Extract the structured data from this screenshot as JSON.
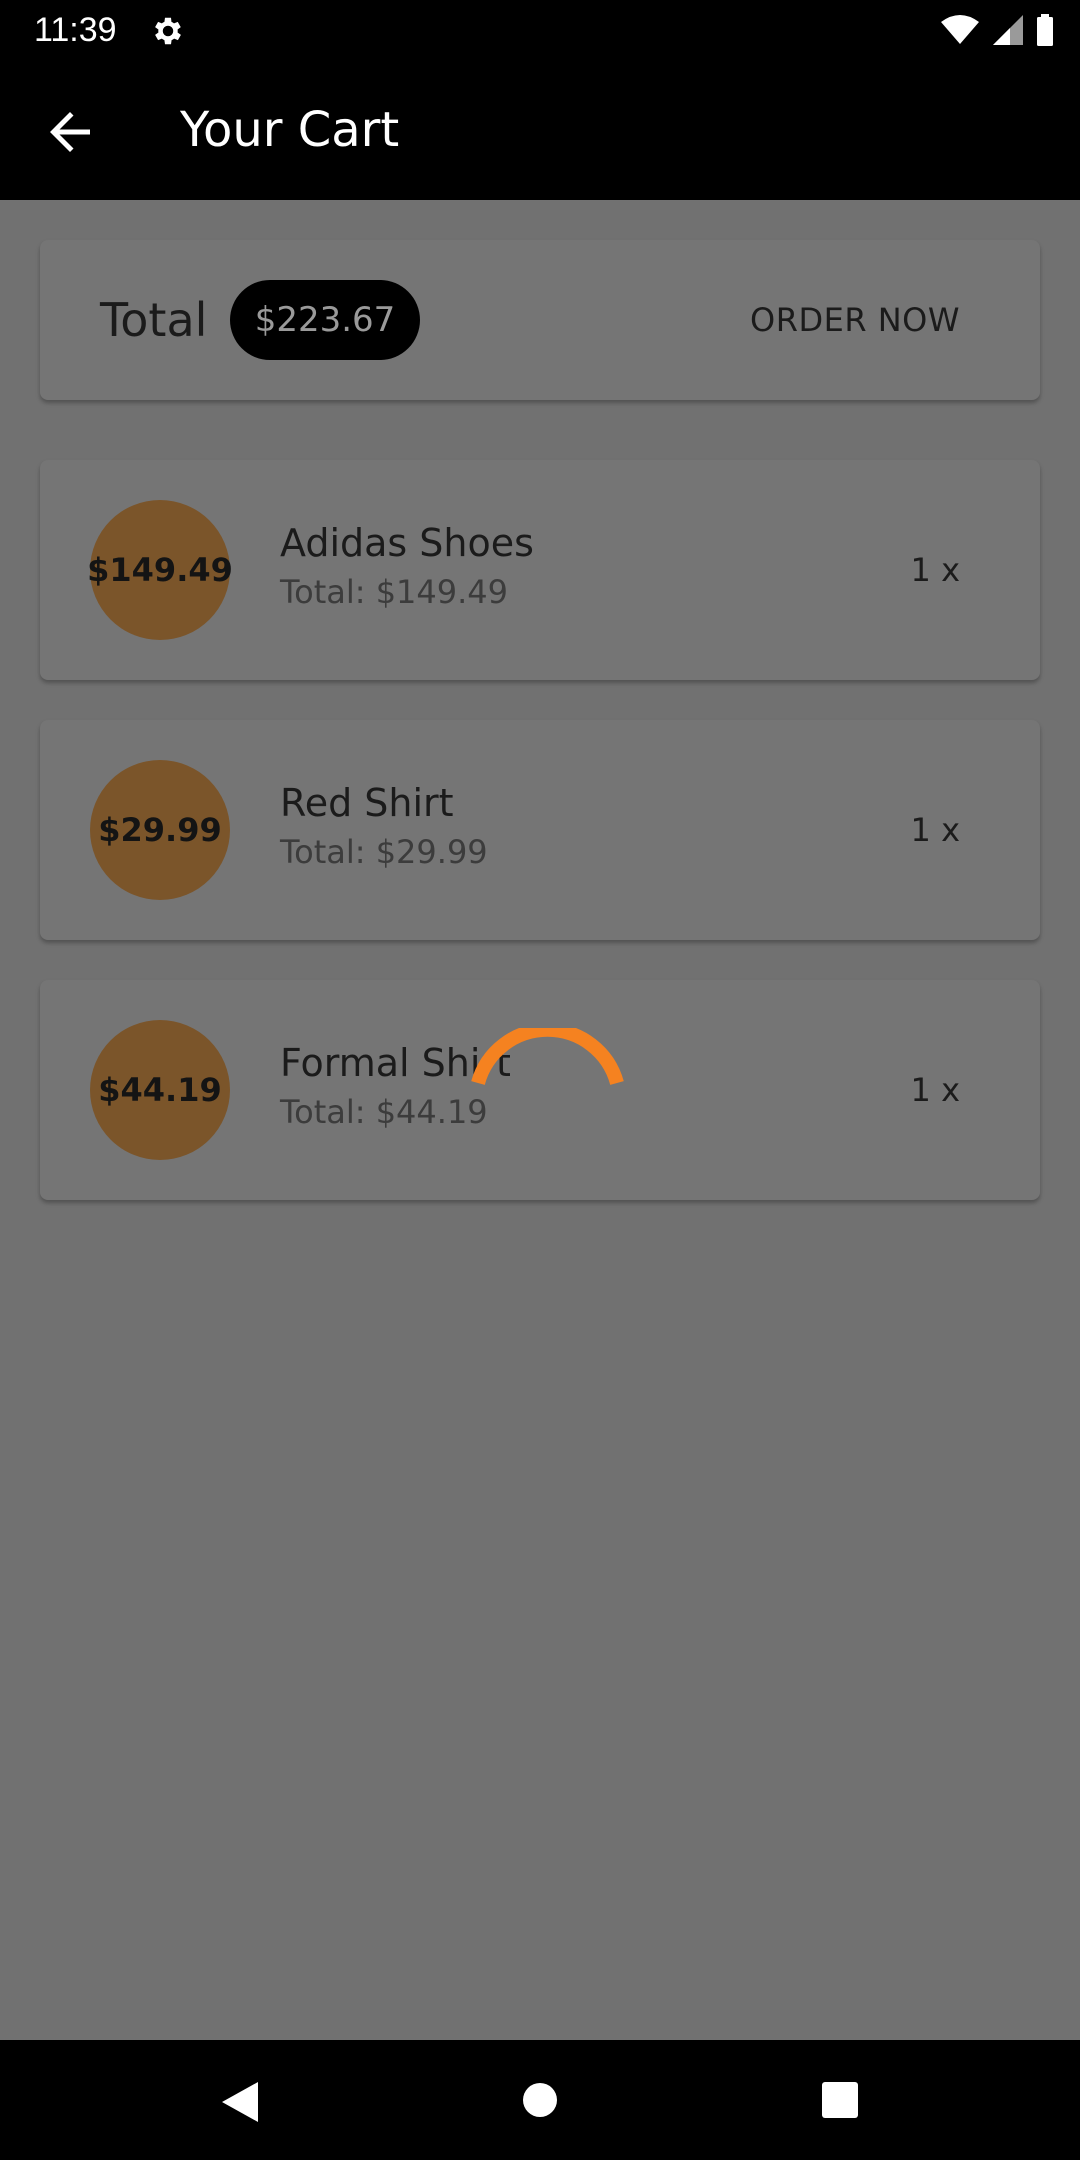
{
  "status_bar": {
    "time": "11:39"
  },
  "app_bar": {
    "title": "Your Cart"
  },
  "summary": {
    "total_label": "Total",
    "total_amount": "$223.67",
    "order_button": "ORDER NOW"
  },
  "items": [
    {
      "price": "$149.49",
      "name": "Adidas Shoes",
      "total": "Total: $149.49",
      "quantity": "1 x"
    },
    {
      "price": "$29.99",
      "name": "Red Shirt",
      "total": "Total: $29.99",
      "quantity": "1 x"
    },
    {
      "price": "$44.19",
      "name": "Formal Shirt",
      "total": "Total: $44.19",
      "quantity": "1 x"
    }
  ],
  "colors": {
    "accent": "#F58220",
    "price_circle": "#7B552A",
    "scrim_background": "#717171"
  },
  "icons": {
    "status": [
      "gear-icon",
      "wifi-icon",
      "signal-icon",
      "battery-icon"
    ],
    "app_bar": [
      "back-arrow-icon"
    ],
    "nav": [
      "nav-back-icon",
      "nav-home-icon",
      "nav-recents-icon"
    ]
  }
}
